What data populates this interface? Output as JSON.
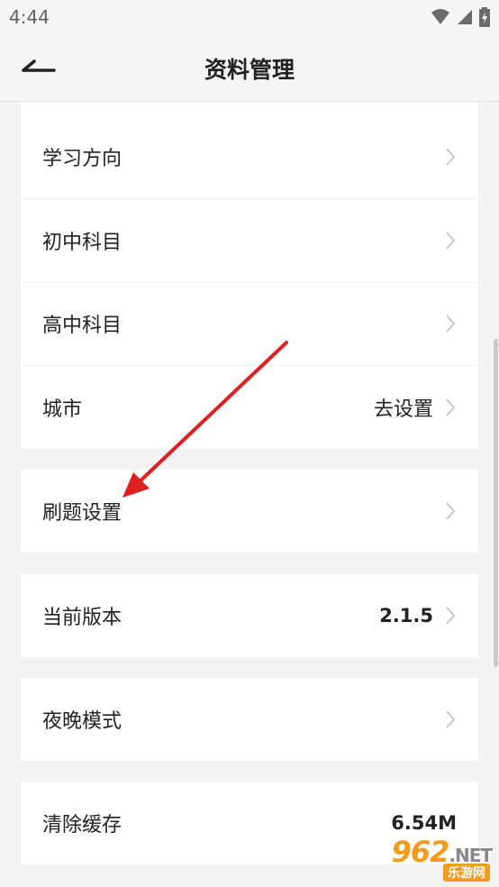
{
  "status_bar": {
    "time": "4:44"
  },
  "app_bar": {
    "title": "资料管理"
  },
  "groups": [
    {
      "rows": [
        {
          "label": "学习方向",
          "value": ""
        },
        {
          "label": "初中科目",
          "value": ""
        },
        {
          "label": "高中科目",
          "value": ""
        },
        {
          "label": "城市",
          "value": "去设置"
        }
      ]
    },
    {
      "rows": [
        {
          "label": "刷题设置",
          "value": ""
        }
      ]
    },
    {
      "rows": [
        {
          "label": "当前版本",
          "value": "2.1.5"
        }
      ]
    },
    {
      "rows": [
        {
          "label": "夜晚模式",
          "value": ""
        }
      ]
    },
    {
      "rows": [
        {
          "label": "清除缓存",
          "value": "6.54M"
        }
      ]
    }
  ],
  "watermark": {
    "main": "962",
    "domain": ".NET",
    "sub": "乐游网"
  },
  "colors": {
    "annotation_arrow": "#e02020",
    "watermark": "#f39b1c"
  }
}
